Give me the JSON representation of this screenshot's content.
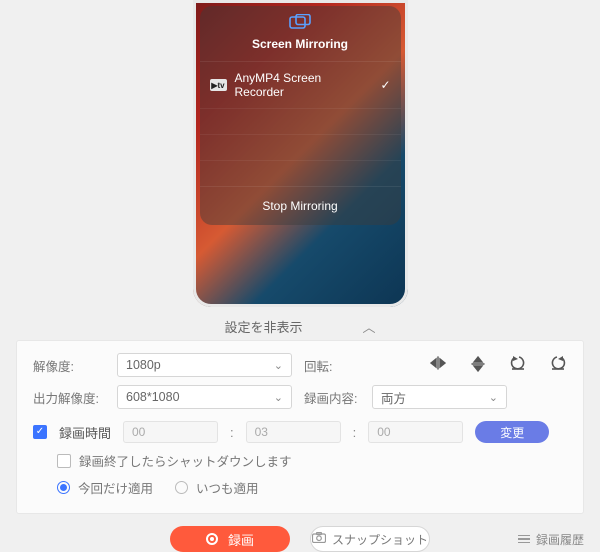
{
  "preview": {
    "mirroring_title": "Screen Mirroring",
    "device_name": "AnyMP4 Screen Recorder",
    "atv_badge": "▶tv",
    "stop_label": "Stop Mirroring"
  },
  "toggle": {
    "label": "設定を非表示"
  },
  "settings": {
    "resolution_label": "解像度:",
    "resolution_value": "1080p",
    "output_resolution_label": "出力解像度:",
    "output_resolution_value": "608*1080",
    "rotation_label": "回転:",
    "content_label": "録画内容:",
    "content_value": "両方"
  },
  "schedule": {
    "duration_label": "録画時間",
    "hh": "00",
    "mm": "03",
    "ss": "00",
    "change_btn": "変更",
    "shutdown_label": "録画終了したらシャットダウンします",
    "apply_once_label": "今回だけ適用",
    "apply_always_label": "いつも適用"
  },
  "footer": {
    "record_btn": "録画",
    "snapshot_btn": "スナップショット",
    "history_label": "録画履歴"
  }
}
